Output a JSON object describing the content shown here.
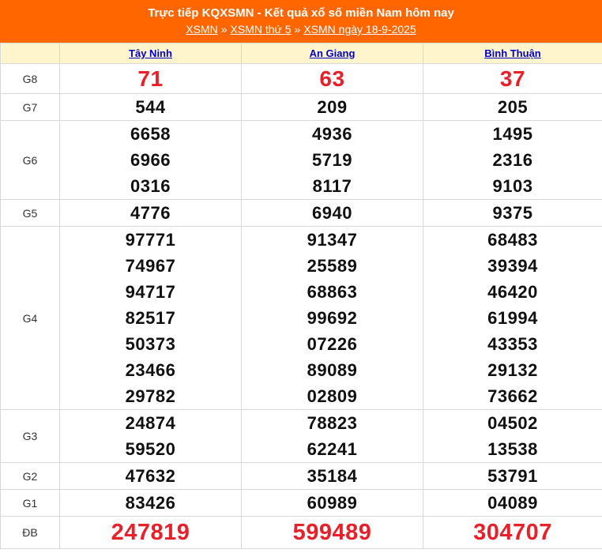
{
  "header": {
    "title": "Trực tiếp KQXSMN - Kết quả xổ số miền Nam hôm nay",
    "breadcrumb": [
      "XSMN",
      "XSMN thứ 5",
      "XSMN ngày 18-9-2025"
    ],
    "separator": "»"
  },
  "colors": {
    "header_bg": "#ff6600",
    "column_header_bg": "#fff5cc",
    "highlight": "#e8202a",
    "link": "#0000cc"
  },
  "provinces": [
    "Tây Ninh",
    "An Giang",
    "Bình Thuận"
  ],
  "rows": [
    {
      "label": "G8",
      "values": [
        [
          "71"
        ],
        [
          "63"
        ],
        [
          "37"
        ]
      ]
    },
    {
      "label": "G7",
      "values": [
        [
          "544"
        ],
        [
          "209"
        ],
        [
          "205"
        ]
      ]
    },
    {
      "label": "G6",
      "values": [
        [
          "6658",
          "6966",
          "0316"
        ],
        [
          "4936",
          "5719",
          "8117"
        ],
        [
          "1495",
          "2316",
          "9103"
        ]
      ]
    },
    {
      "label": "G5",
      "values": [
        [
          "4776"
        ],
        [
          "6940"
        ],
        [
          "9375"
        ]
      ]
    },
    {
      "label": "G4",
      "values": [
        [
          "97771",
          "74967",
          "94717",
          "82517",
          "50373",
          "23466",
          "29782"
        ],
        [
          "91347",
          "25589",
          "68863",
          "99692",
          "07226",
          "89089",
          "02809"
        ],
        [
          "68483",
          "39394",
          "46420",
          "61994",
          "43353",
          "29132",
          "73662"
        ]
      ]
    },
    {
      "label": "G3",
      "values": [
        [
          "24874",
          "59520"
        ],
        [
          "78823",
          "62241"
        ],
        [
          "04502",
          "13538"
        ]
      ]
    },
    {
      "label": "G2",
      "values": [
        [
          "47632"
        ],
        [
          "35184"
        ],
        [
          "53791"
        ]
      ]
    },
    {
      "label": "G1",
      "values": [
        [
          "83426"
        ],
        [
          "60989"
        ],
        [
          "04089"
        ]
      ]
    },
    {
      "label": "ĐB",
      "values": [
        [
          "247819"
        ],
        [
          "599489"
        ],
        [
          "304707"
        ]
      ]
    }
  ]
}
